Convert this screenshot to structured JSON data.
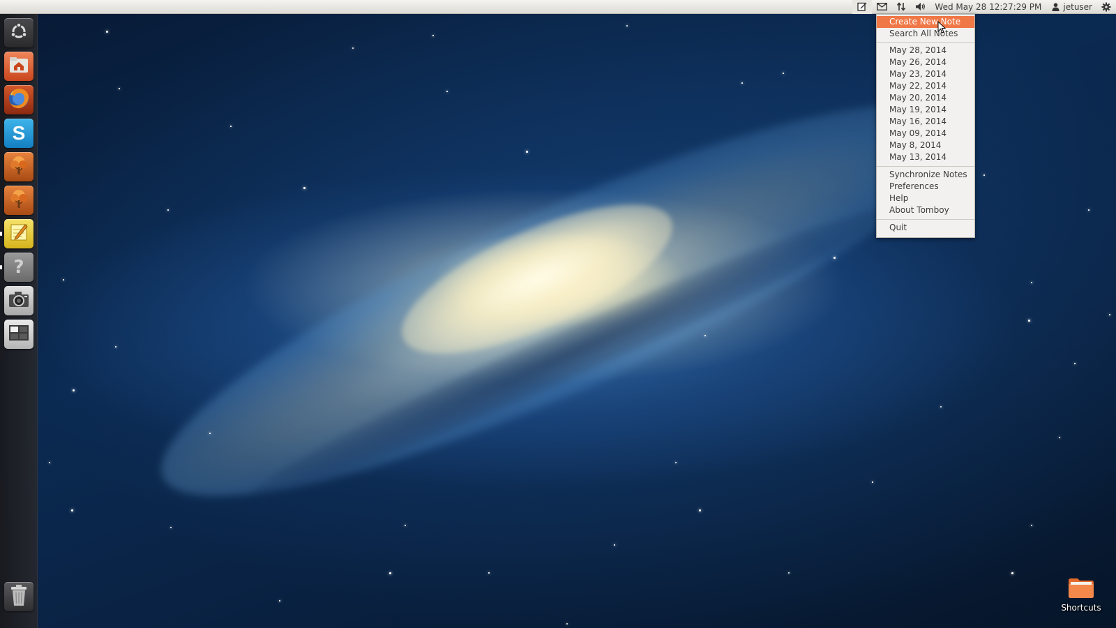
{
  "top_panel": {
    "datetime": "Wed May 28 12:27:29 PM",
    "username": "jetuser",
    "icons": [
      "tomboy-notes-icon",
      "mail-icon",
      "network-icon",
      "volume-icon",
      "user-icon",
      "gear-icon"
    ]
  },
  "launcher": {
    "items": [
      {
        "name": "dash-home",
        "icon": "ubuntu-logo-icon"
      },
      {
        "name": "home-folder",
        "icon": "home-folder-icon"
      },
      {
        "name": "firefox",
        "icon": "firefox-icon"
      },
      {
        "name": "skype",
        "icon": "skype-icon"
      },
      {
        "name": "app-tree-1",
        "icon": "tree-icon"
      },
      {
        "name": "app-tree-2",
        "icon": "tree-icon"
      },
      {
        "name": "tomboy-notes",
        "icon": "notepad-icon"
      },
      {
        "name": "help",
        "icon": "question-mark-icon"
      },
      {
        "name": "screenshot",
        "icon": "camera-icon"
      },
      {
        "name": "workspace-switcher",
        "icon": "workspace-icon"
      },
      {
        "name": "trash",
        "icon": "trash-icon"
      }
    ]
  },
  "menu": {
    "create_new_note": "Create New Note",
    "search_all_notes": "Search All Notes",
    "notes": [
      "May 28, 2014",
      "May 26, 2014",
      "May 23, 2014",
      "May 22, 2014",
      "May 20, 2014",
      "May 19, 2014",
      "May 16, 2014",
      "May 09, 2014",
      "May 8, 2014",
      "May 13, 2014"
    ],
    "synchronize_notes": "Synchronize Notes",
    "preferences": "Preferences",
    "help": "Help",
    "about": "About Tomboy",
    "quit": "Quit"
  },
  "desktop": {
    "shortcut_label": "Shortcuts"
  },
  "colors": {
    "menu_highlight": "#f07746",
    "panel_bg": "#e6e4df",
    "launcher_bg": "#232326"
  }
}
